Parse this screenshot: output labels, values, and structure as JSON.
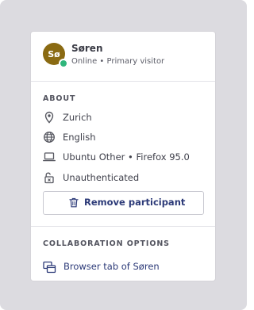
{
  "participant": {
    "initials": "Sø",
    "name": "Søren",
    "subtitle": "Online • Primary visitor",
    "status_color": "#2fb67c",
    "avatar_color": "#8a6a12"
  },
  "about": {
    "title": "ABOUT",
    "items": [
      {
        "icon": "location-pin-icon",
        "label": "Zurich"
      },
      {
        "icon": "globe-icon",
        "label": "English"
      },
      {
        "icon": "laptop-icon",
        "label": "Ubuntu Other • Firefox 95.0"
      },
      {
        "icon": "unlocked-padlock-icon",
        "label": "Unauthenticated"
      }
    ]
  },
  "actions": {
    "remove_label": "Remove participant",
    "remove_icon": "trash-icon"
  },
  "collaboration": {
    "title": "COLLABORATION OPTIONS",
    "items": [
      {
        "icon": "browser-tab-icon",
        "label": "Browser tab of Søren"
      }
    ]
  },
  "colors": {
    "accent": "#2c3a78",
    "background": "#dcdbe0"
  }
}
